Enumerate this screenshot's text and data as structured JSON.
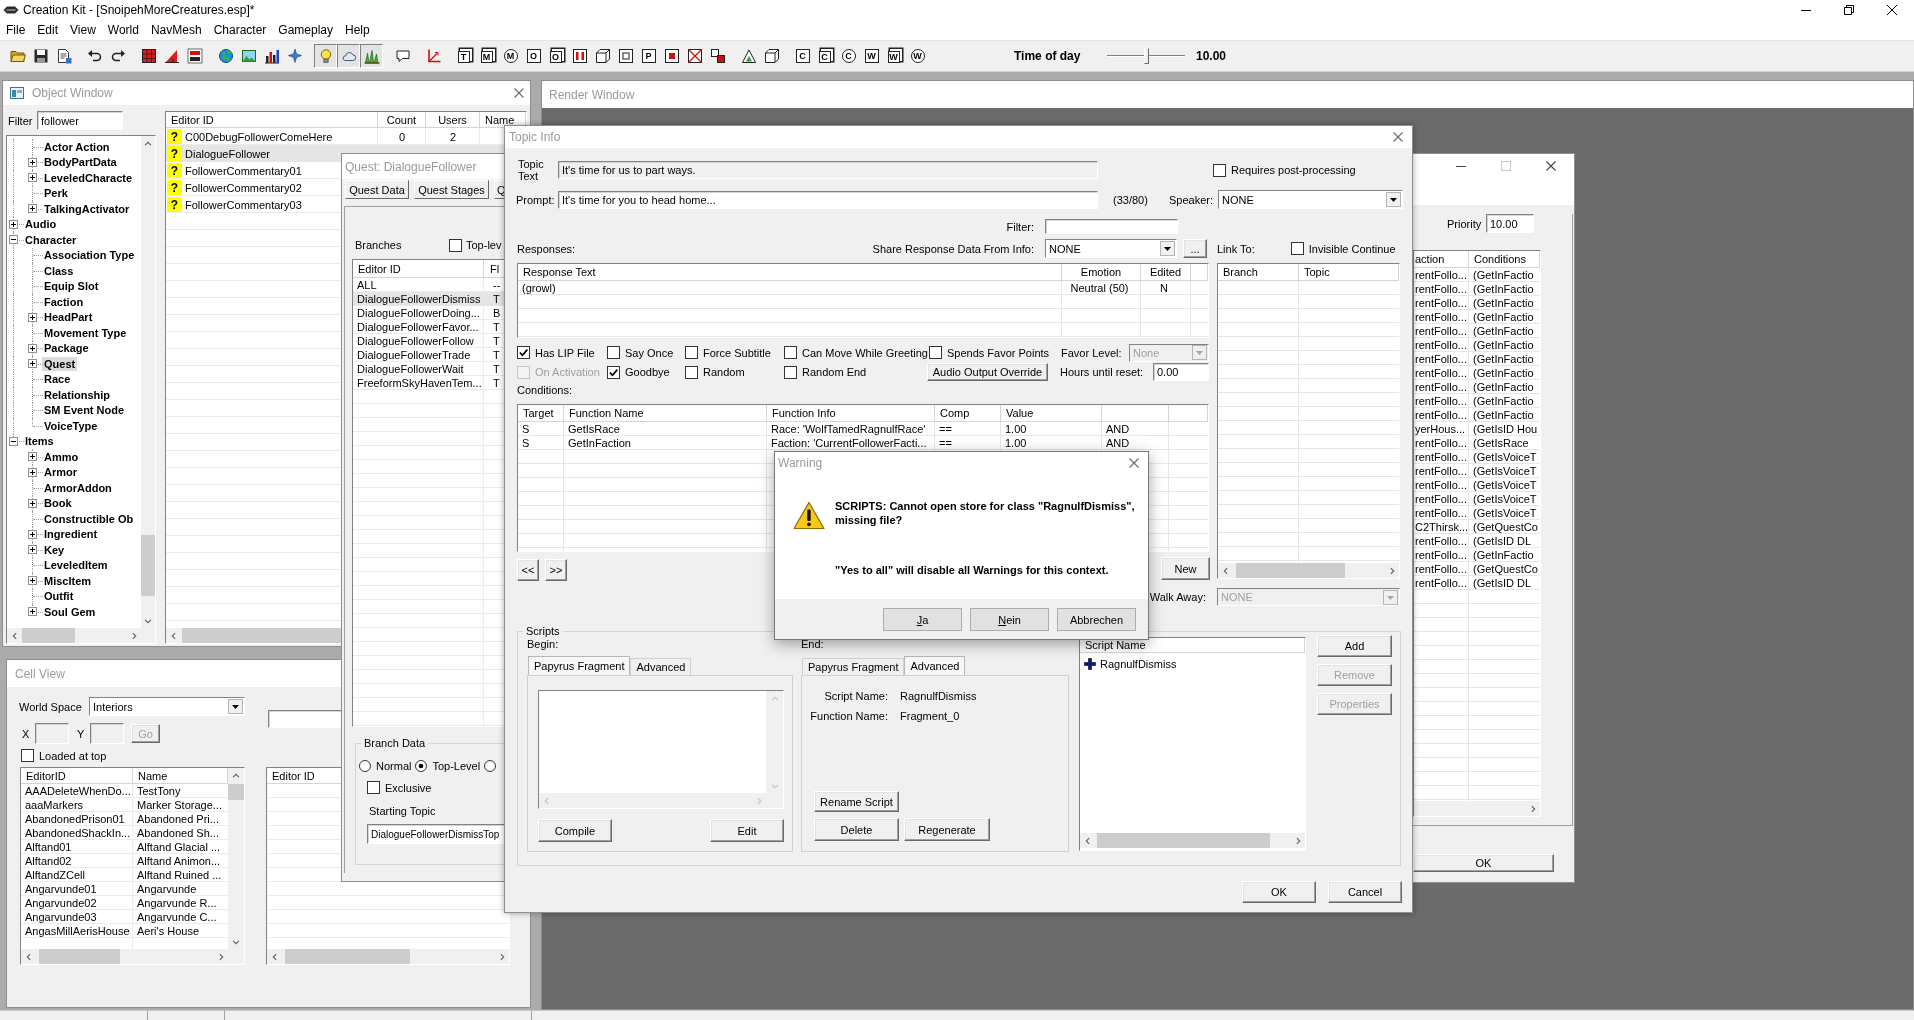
{
  "window": {
    "title": "Creation Kit - [SnoipehMoreCreatures.esp]*"
  },
  "menu": [
    "File",
    "Edit",
    "View",
    "World",
    "NavMesh",
    "Character",
    "Gameplay",
    "Help"
  ],
  "toolbar": {
    "groups": [
      [
        {
          "kind": "image",
          "pressed": false
        },
        {
          "kind": "image",
          "pressed": false
        },
        {
          "kind": "image",
          "pressed": false
        }
      ],
      [
        {
          "kind": "image",
          "pressed": false
        },
        {
          "kind": "image",
          "pressed": false
        }
      ],
      [
        {
          "kind": "image",
          "pressed": false
        },
        {
          "kind": "image",
          "pressed": false
        },
        {
          "kind": "image",
          "pressed": false
        }
      ],
      [
        {
          "kind": "image",
          "pressed": false
        },
        {
          "kind": "image",
          "pressed": false
        },
        {
          "kind": "image",
          "pressed": false
        },
        {
          "kind": "image",
          "pressed": false
        }
      ],
      [
        {
          "kind": "image",
          "pressed": true
        },
        {
          "kind": "image",
          "pressed": true
        },
        {
          "kind": "image",
          "pressed": true
        }
      ],
      [
        {
          "kind": "image",
          "pressed": false
        }
      ],
      [
        {
          "kind": "image",
          "pressed": false
        }
      ],
      [
        {
          "kind": "cube",
          "glyph": "T",
          "pressed": false
        },
        {
          "kind": "cube",
          "glyph": "M",
          "pressed": false
        },
        {
          "kind": "ring",
          "glyph": "M",
          "pressed": false
        },
        {
          "kind": "box",
          "glyph": "O",
          "pressed": false
        },
        {
          "kind": "cube",
          "glyph": "O",
          "pressed": false
        },
        {
          "kind": "image",
          "pressed": false
        },
        {
          "kind": "image",
          "pressed": false
        },
        {
          "kind": "image",
          "pressed": false
        },
        {
          "kind": "box",
          "glyph": "P",
          "pressed": false
        },
        {
          "kind": "image",
          "pressed": false
        },
        {
          "kind": "image",
          "pressed": false
        },
        {
          "kind": "image",
          "pressed": false
        }
      ],
      [
        {
          "kind": "image",
          "pressed": false
        },
        {
          "kind": "image",
          "pressed": false
        }
      ],
      [
        {
          "kind": "box",
          "glyph": "C",
          "pressed": false
        },
        {
          "kind": "cube",
          "glyph": "C",
          "pressed": false
        },
        {
          "kind": "ring",
          "glyph": "C",
          "pressed": false
        },
        {
          "kind": "box",
          "glyph": "W",
          "pressed": false
        },
        {
          "kind": "cube",
          "glyph": "W",
          "pressed": false
        },
        {
          "kind": "ring",
          "glyph": "W",
          "pressed": false
        }
      ]
    ],
    "time_of_day": {
      "label": "Time of day",
      "level": 0.5,
      "value": "10.00"
    }
  },
  "render_window": {
    "title": "Render Window"
  },
  "object_window": {
    "title": "Object Window",
    "filter": {
      "label": "Filter",
      "value": "follower"
    },
    "tree": {
      "items": [
        {
          "children": [
            {
              "label": "Actor Action",
              "selected": false
            },
            {
              "label": "BodyPartData",
              "expanded": false,
              "selected": false
            },
            {
              "label": "LeveledCharacte",
              "expanded": false,
              "selected": false
            },
            {
              "label": "Perk",
              "selected": false
            },
            {
              "label": "TalkingActivator",
              "expanded": false,
              "selected": false
            }
          ]
        },
        {
          "label": "Audio",
          "expanded": false,
          "selected": false
        },
        {
          "label": "Character",
          "expanded": true,
          "selected": false,
          "children": [
            {
              "label": "Association Type",
              "selected": false
            },
            {
              "label": "Class",
              "selected": false
            },
            {
              "label": "Equip Slot",
              "selected": false
            },
            {
              "label": "Faction",
              "selected": false
            },
            {
              "label": "HeadPart",
              "expanded": false,
              "selected": false
            },
            {
              "label": "Movement Type",
              "selected": false
            },
            {
              "label": "Package",
              "expanded": false,
              "selected": false
            },
            {
              "label": "Quest",
              "expanded": false,
              "selected": true
            },
            {
              "label": "Race",
              "selected": false
            },
            {
              "label": "Relationship",
              "selected": false
            },
            {
              "label": "SM Event Node",
              "selected": false
            },
            {
              "label": "VoiceType",
              "selected": false
            }
          ]
        },
        {
          "label": "Items",
          "expanded": true,
          "selected": false,
          "children": [
            {
              "label": "Ammo",
              "expanded": false,
              "selected": false
            },
            {
              "label": "Armor",
              "expanded": false,
              "selected": false
            },
            {
              "label": "ArmorAddon",
              "selected": false
            },
            {
              "label": "Book",
              "expanded": false,
              "selected": false
            },
            {
              "label": "Constructible Ob",
              "selected": false
            },
            {
              "label": "Ingredient",
              "expanded": false,
              "selected": false
            },
            {
              "label": "Key",
              "expanded": false,
              "selected": false
            },
            {
              "label": "LeveledItem",
              "selected": false
            },
            {
              "label": "MiscItem",
              "expanded": false,
              "selected": false
            },
            {
              "label": "Outfit",
              "selected": false
            },
            {
              "label": "Soul Gem",
              "expanded": false,
              "selected": false
            }
          ]
        }
      ]
    },
    "list": {
      "columns": [
        "Editor ID",
        "Count",
        "Users",
        "Name"
      ],
      "rows": [
        {
          "mark": "?",
          "editor_id": "C00DebugFollowerComeHere",
          "count": "0",
          "users": "2",
          "selected": false
        },
        {
          "mark": "?",
          "editor_id": "DialogueFollower",
          "selected": true
        },
        {
          "mark": "?",
          "editor_id": "FollowerCommentary01",
          "selected": false
        },
        {
          "mark": "?",
          "editor_id": "FollowerCommentary02",
          "selected": false
        },
        {
          "mark": "?",
          "editor_id": "FollowerCommentary03",
          "selected": false
        }
      ]
    }
  },
  "cell_view": {
    "title": "Cell View",
    "world_space": {
      "label": "World Space",
      "value": "Interiors"
    },
    "x": {
      "label": "X",
      "disabled": true
    },
    "y": {
      "label": "Y",
      "disabled": true
    },
    "go": {
      "label": "Go",
      "disabled": true
    },
    "loaded_at_top": {
      "label": "Loaded at top",
      "checked": false
    },
    "cells": {
      "columns": [
        "EditorID",
        "Name"
      ],
      "rows": [
        {
          "cells": [
            "AAADeleteWhenDo...",
            "TestTony"
          ],
          "selected": false
        },
        {
          "cells": [
            "aaaMarkers",
            "Marker Storage..."
          ],
          "selected": false
        },
        {
          "cells": [
            "AbandonedPrison01",
            "Abandoned Pri..."
          ],
          "selected": false
        },
        {
          "cells": [
            "AbandonedShackIn...",
            "Abandoned Sh..."
          ],
          "selected": false
        },
        {
          "cells": [
            "Alftand01",
            "Alftand Glacial ..."
          ],
          "selected": false
        },
        {
          "cells": [
            "Alftand02",
            "Alftand Animon..."
          ],
          "selected": false
        },
        {
          "cells": [
            "AlftandZCell",
            "Alftand Ruined ..."
          ],
          "selected": false
        },
        {
          "cells": [
            "Angarvunde01",
            "Angarvunde"
          ],
          "selected": false
        },
        {
          "cells": [
            "Angarvunde02",
            "Angarvunde R..."
          ],
          "selected": false
        },
        {
          "cells": [
            "Angarvunde03",
            "Angarvunde C..."
          ],
          "selected": false
        },
        {
          "cells": [
            "AngasMillAerisHouse",
            "Aeri's House"
          ],
          "selected": false
        }
      ]
    },
    "references": {
      "columns": [
        "Editor ID"
      ]
    }
  },
  "quest_window": {
    "title": "Quest: DialogueFollower",
    "tabs": [
      {
        "label": "Quest Data",
        "selected": false
      },
      {
        "label": "Quest Stages",
        "selected": false
      },
      {
        "label": "Q",
        "selected": false
      }
    ],
    "branches": {
      "label": "Branches",
      "top_level": {
        "label": "Top-lev",
        "checked": false
      },
      "columns": [
        "Editor ID",
        "Fl"
      ],
      "rows": [
        {
          "cells": [
            "ALL",
            "--"
          ],
          "selected": false
        },
        {
          "cells": [
            "DialogueFollowerDismiss",
            "T"
          ],
          "selected": true
        },
        {
          "cells": [
            "DialogueFollowerDoing...",
            "B"
          ],
          "selected": false
        },
        {
          "cells": [
            "DialogueFollowerFavor...",
            "T"
          ],
          "selected": false
        },
        {
          "cells": [
            "DialogueFollowerFollow",
            "T"
          ],
          "selected": false
        },
        {
          "cells": [
            "DialogueFollowerTrade",
            "T"
          ],
          "selected": false
        },
        {
          "cells": [
            "DialogueFollowerWait",
            "T"
          ],
          "selected": false
        },
        {
          "cells": [
            "FreeformSkyHavenTem...",
            "T"
          ],
          "selected": false
        }
      ]
    },
    "branch_data": {
      "label": "Branch Data",
      "types": [
        {
          "label": "Normal",
          "selected": false
        },
        {
          "label": "Top-Level",
          "selected": true
        },
        {
          "selected": false
        }
      ],
      "exclusive": {
        "label": "Exclusive",
        "checked": false
      },
      "starting_topic": {
        "label": "Starting Topic",
        "value": "DialogueFollowerDismissTop"
      }
    }
  },
  "side_dialog": {
    "priority": {
      "label": "Priority",
      "value": "10.00"
    },
    "columns": [
      "action",
      "Conditions"
    ],
    "rows": [
      {
        "cells": [
          "rentFollo...",
          "(GetInFactio"
        ],
        "selected": false
      },
      {
        "cells": [
          "rentFollo...",
          "(GetInFactio"
        ],
        "selected": false
      },
      {
        "cells": [
          "rentFollo...",
          "(GetInFactio"
        ],
        "selected": false
      },
      {
        "cells": [
          "rentFollo...",
          "(GetInFactio"
        ],
        "selected": false
      },
      {
        "cells": [
          "rentFollo...",
          "(GetInFactio"
        ],
        "selected": false
      },
      {
        "cells": [
          "rentFollo...",
          "(GetInFactio"
        ],
        "selected": false
      },
      {
        "cells": [
          "rentFollo...",
          "(GetInFactio"
        ],
        "selected": false
      },
      {
        "cells": [
          "rentFollo...",
          "(GetInFactio"
        ],
        "selected": false
      },
      {
        "cells": [
          "rentFollo...",
          "(GetInFactio"
        ],
        "selected": false
      },
      {
        "cells": [
          "rentFollo...",
          "(GetInFactio"
        ],
        "selected": false
      },
      {
        "cells": [
          "rentFollo...",
          "(GetInFactio"
        ],
        "selected": false
      },
      {
        "cells": [
          "yerHous...",
          "(GetIsID Hou"
        ],
        "selected": false
      },
      {
        "cells": [
          "rentFollo...",
          "(GetIsRace"
        ],
        "selected": false
      },
      {
        "cells": [
          "rentFollo...",
          "(GetIsVoiceT"
        ],
        "selected": false
      },
      {
        "cells": [
          "rentFollo...",
          "(GetIsVoiceT"
        ],
        "selected": false
      },
      {
        "cells": [
          "rentFollo...",
          "(GetIsVoiceT"
        ],
        "selected": false
      },
      {
        "cells": [
          "rentFollo...",
          "(GetIsVoiceT"
        ],
        "selected": false
      },
      {
        "cells": [
          "rentFollo...",
          "(GetIsVoiceT"
        ],
        "selected": false
      },
      {
        "cells": [
          "C2Thirsk...",
          "(GetQuestCo"
        ],
        "selected": false
      },
      {
        "cells": [
          "rentFollo...",
          "(GetIsID DL"
        ],
        "selected": false
      },
      {
        "cells": [
          "rentFollo...",
          "(GetInFactio"
        ],
        "selected": false
      },
      {
        "cells": [
          "rentFollo...",
          "(GetQuestCo"
        ],
        "selected": false
      },
      {
        "cells": [
          "rentFollo...",
          "(GetIsID DL"
        ],
        "selected": false
      }
    ],
    "ok_button": "OK"
  },
  "topic_info": {
    "title": "Topic Info",
    "topic_text": {
      "label": "Topic Text",
      "value": "It's time for us to part ways.",
      "read_only": true
    },
    "requires_post_processing": {
      "label": "Requires post-processing",
      "checked": false
    },
    "prompt": {
      "label": "Prompt:",
      "value": "It's time for you to head home...",
      "read_only": false,
      "count": "(33/80)"
    },
    "speaker": {
      "label": "Speaker:",
      "value": "NONE"
    },
    "filter": {
      "label": "Filter:"
    },
    "share_response": {
      "label": "Share Response Data From Info:",
      "value": "NONE",
      "button": "..."
    },
    "link_to": {
      "label": "Link To:",
      "invisible_continue": {
        "label": "Invisible Continue",
        "checked": false
      },
      "columns": [
        "Branch",
        "Topic"
      ]
    },
    "responses": {
      "label": "Responses:",
      "columns": [
        "Response Text",
        "Emotion",
        "Edited"
      ],
      "rows": [
        {
          "cells": [
            "(growl)",
            "Neutral (50)",
            "N"
          ],
          "selected": false
        }
      ]
    },
    "flags": [
      [
        {
          "label": "Has LIP File",
          "checked": true,
          "disabled": false
        },
        {
          "label": "Say Once",
          "checked": false,
          "disabled": false
        },
        {
          "label": "Force Subtitle",
          "checked": false,
          "disabled": false
        },
        {
          "label": "Can Move While Greeting",
          "checked": false,
          "disabled": false
        },
        {
          "label": "Spends Favor Points",
          "checked": false,
          "disabled": false
        }
      ],
      [
        {
          "label": "On Activation",
          "checked": false,
          "disabled": true
        },
        {
          "label": "Goodbye",
          "checked": true,
          "disabled": false
        },
        {
          "label": "Random",
          "checked": false,
          "disabled": false
        },
        {
          "label": "Random End",
          "checked": false,
          "disabled": false
        }
      ]
    ],
    "favor_level": {
      "label": "Favor Level:",
      "value": "None",
      "disabled": true
    },
    "audio_output_override": "Audio Output Override",
    "hours_until_reset": {
      "label": "Hours until reset:",
      "value": "0.00"
    },
    "conditions": {
      "label": "Conditions:",
      "columns": [
        "Target",
        "Function Name",
        "Function Info",
        "Comp",
        "Value"
      ],
      "rows": [
        {
          "cells": [
            "S",
            "GetIsRace",
            "Race: 'WolfTamedRagnulfRace'",
            "==",
            "1.00",
            "AND"
          ],
          "selected": false
        },
        {
          "cells": [
            "S",
            "GetInFaction",
            "Faction: 'CurrentFollowerFacti...",
            "==",
            "1.00",
            "AND"
          ],
          "selected": false
        }
      ]
    },
    "nav_buttons": [
      "<<",
      ">>"
    ],
    "new_button": "New",
    "walk_away": {
      "label": "Walk Away:",
      "value": "NONE",
      "disabled": true
    },
    "scripts": {
      "label": "Scripts",
      "begin": {
        "label": "Begin:",
        "tabs": [
          {
            "label": "Papyrus Fragment",
            "selected": true
          },
          {
            "label": "Advanced",
            "selected": false
          }
        ],
        "buttons": [
          "Compile",
          "Edit"
        ]
      },
      "end": {
        "label": "End:",
        "tabs": [
          {
            "label": "Papyrus Fragment",
            "selected": false
          },
          {
            "label": "Advanced",
            "selected": true
          }
        ],
        "fields": [
          {
            "label": "Script Name:",
            "value": "RagnulfDismiss"
          },
          {
            "label": "Function Name:",
            "value": "Fragment_0"
          }
        ],
        "buttons": [
          "Rename Script",
          "Delete",
          "Regenerate"
        ]
      },
      "script_list": {
        "column": "Script Name",
        "items": [
          {
            "name": "RagnulfDismiss",
            "selected": false
          }
        ]
      },
      "buttons": [
        {
          "label": "Add",
          "disabled": false
        },
        {
          "label": "Remove",
          "disabled": true
        },
        {
          "label": "Properties",
          "disabled": true
        }
      ]
    },
    "buttons": [
      "OK",
      "Cancel"
    ]
  },
  "warning": {
    "title": "Warning",
    "message": "SCRIPTS: Cannot open store for class \"RagnulfDismiss\", missing file?",
    "note": "\"Yes to all\" will disable all Warnings for this context.",
    "buttons": [
      {
        "label": "Ja",
        "mnemonic": true
      },
      {
        "label": "Nein",
        "mnemonic": true
      },
      {
        "label": "Abbrechen",
        "mnemonic": false
      }
    ]
  }
}
